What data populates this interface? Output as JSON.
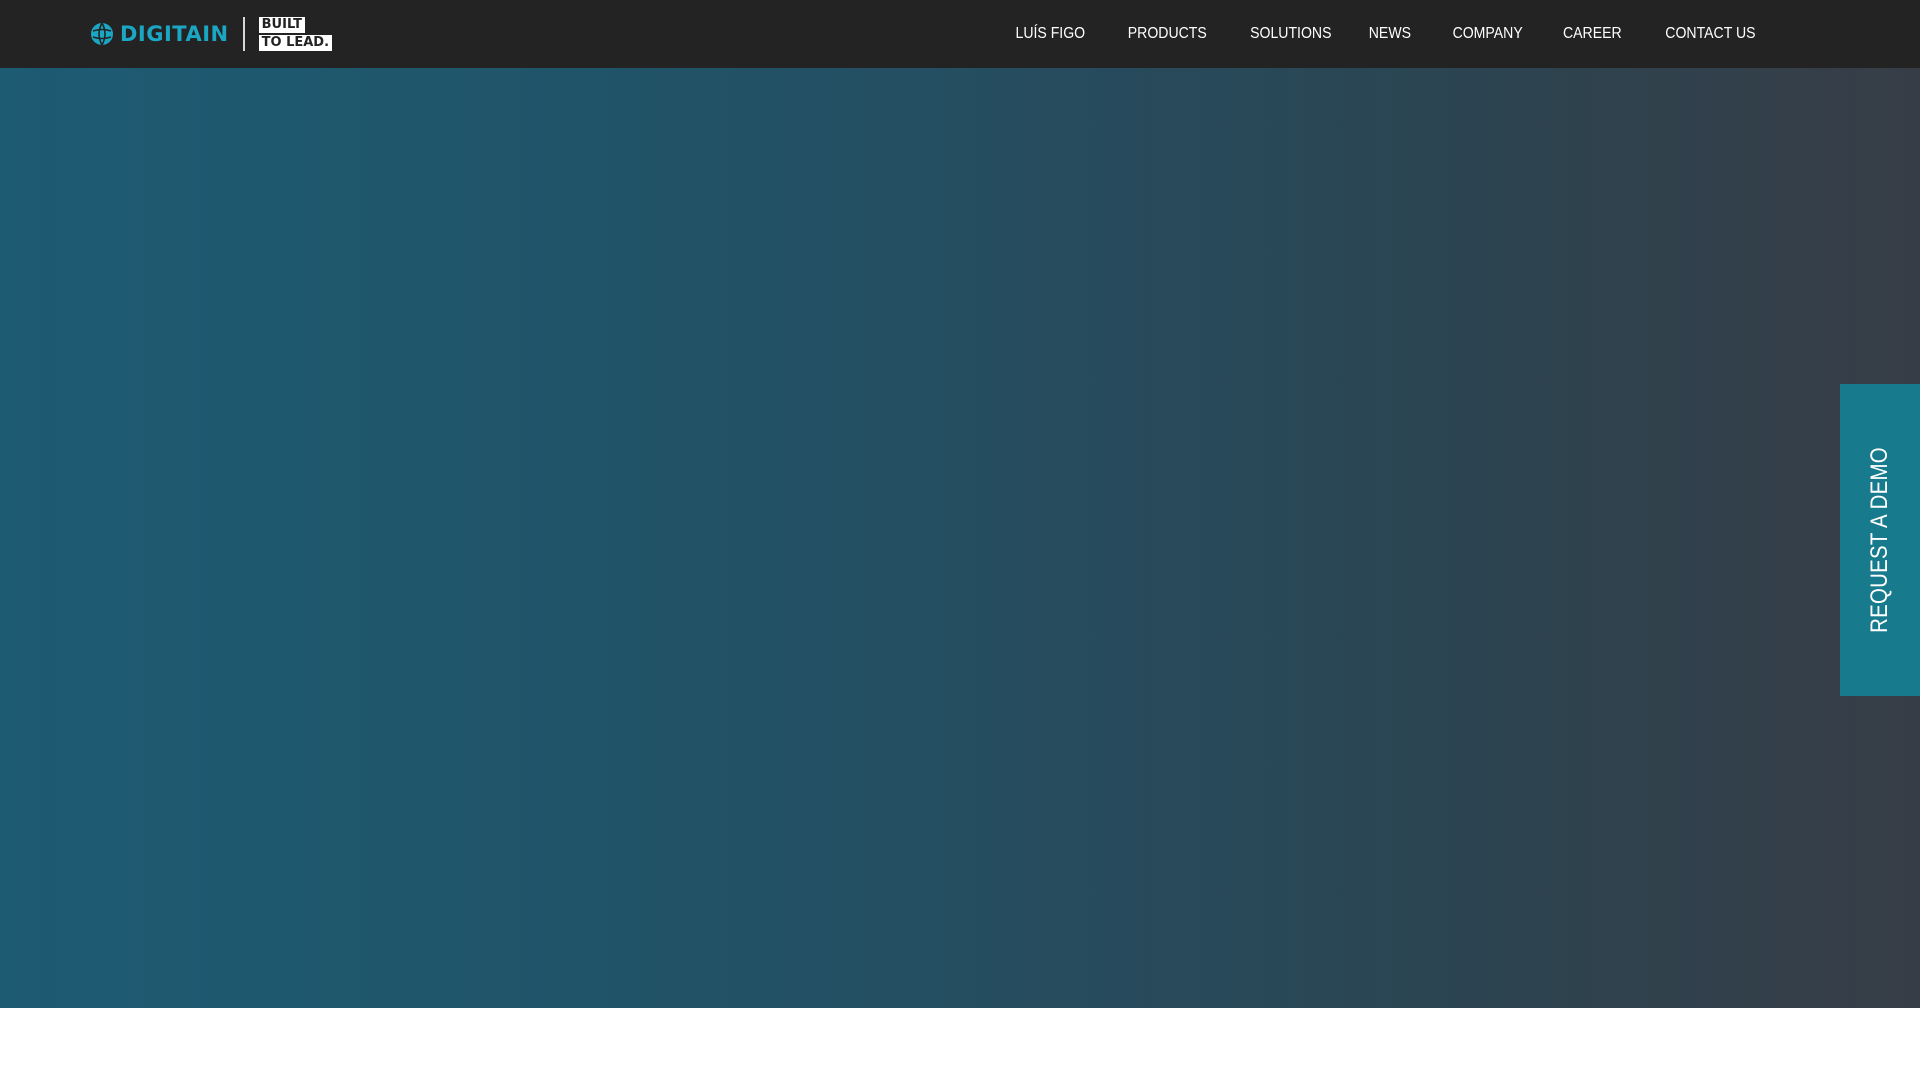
{
  "header": {
    "logo": {
      "word": "DIGITAIN",
      "tagline_lines": [
        "BUILT",
        "TO LEAD."
      ],
      "icon": "globe-icon",
      "brand_color": "#1ba7c4"
    },
    "nav_items": [
      {
        "label": "LUÍS FIGO"
      },
      {
        "label": "PRODUCTS"
      },
      {
        "label": "SOLUTIONS"
      },
      {
        "label": "NEWS"
      },
      {
        "label": "COMPANY"
      },
      {
        "label": "CAREER"
      },
      {
        "label": "CONTACT US"
      }
    ]
  },
  "hero": {
    "gradient_colors": [
      "#1d5b73",
      "#373d47"
    ],
    "scroll_icon": "chevron-down-icon"
  },
  "side_cta": {
    "label": "REQUEST A DEMO",
    "color": "#177a8d"
  }
}
